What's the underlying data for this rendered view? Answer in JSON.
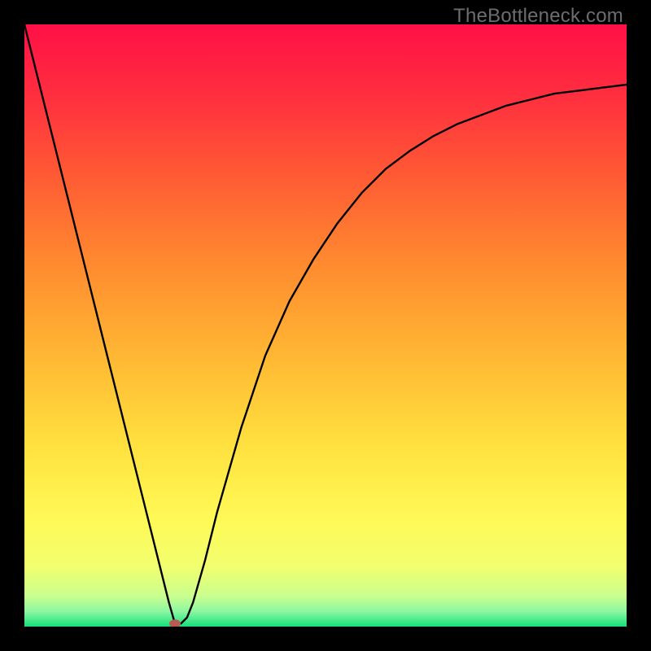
{
  "watermark": "TheBottleneck.com",
  "chart_data": {
    "type": "line",
    "title": "",
    "xlabel": "",
    "ylabel": "",
    "xlim": [
      0,
      100
    ],
    "ylim": [
      0,
      100
    ],
    "series": [
      {
        "name": "bottleneck-curve",
        "x": [
          0,
          2,
          4,
          6,
          8,
          10,
          12,
          14,
          16,
          18,
          20,
          22,
          24,
          25,
          26,
          27,
          28,
          30,
          32,
          34,
          36,
          38,
          40,
          44,
          48,
          52,
          56,
          60,
          64,
          68,
          72,
          76,
          80,
          84,
          88,
          92,
          96,
          100
        ],
        "y": [
          100,
          92,
          84,
          76,
          68,
          60,
          52,
          44,
          36,
          28,
          20,
          12,
          4,
          0.5,
          0.5,
          1.5,
          4,
          11,
          19,
          26,
          33,
          39,
          45,
          54,
          61,
          67,
          72,
          76,
          79,
          81.5,
          83.5,
          85,
          86.5,
          87.5,
          88.5,
          89,
          89.5,
          90
        ]
      }
    ],
    "marker": {
      "x": 25,
      "y": 0.5
    },
    "gradient_stops": [
      {
        "offset": 0.0,
        "color": "#ff1046"
      },
      {
        "offset": 0.12,
        "color": "#ff2f3f"
      },
      {
        "offset": 0.25,
        "color": "#ff5a34"
      },
      {
        "offset": 0.4,
        "color": "#ff8b2f"
      },
      {
        "offset": 0.55,
        "color": "#ffb733"
      },
      {
        "offset": 0.7,
        "color": "#ffe13f"
      },
      {
        "offset": 0.82,
        "color": "#fff956"
      },
      {
        "offset": 0.9,
        "color": "#f2ff6e"
      },
      {
        "offset": 0.95,
        "color": "#c9ff8f"
      },
      {
        "offset": 0.975,
        "color": "#8cf7a0"
      },
      {
        "offset": 1.0,
        "color": "#14e07a"
      }
    ]
  },
  "colors": {
    "frame": "#000000",
    "curve": "#000000",
    "marker": "#bb5a53",
    "watermark": "#6d6d6d"
  }
}
